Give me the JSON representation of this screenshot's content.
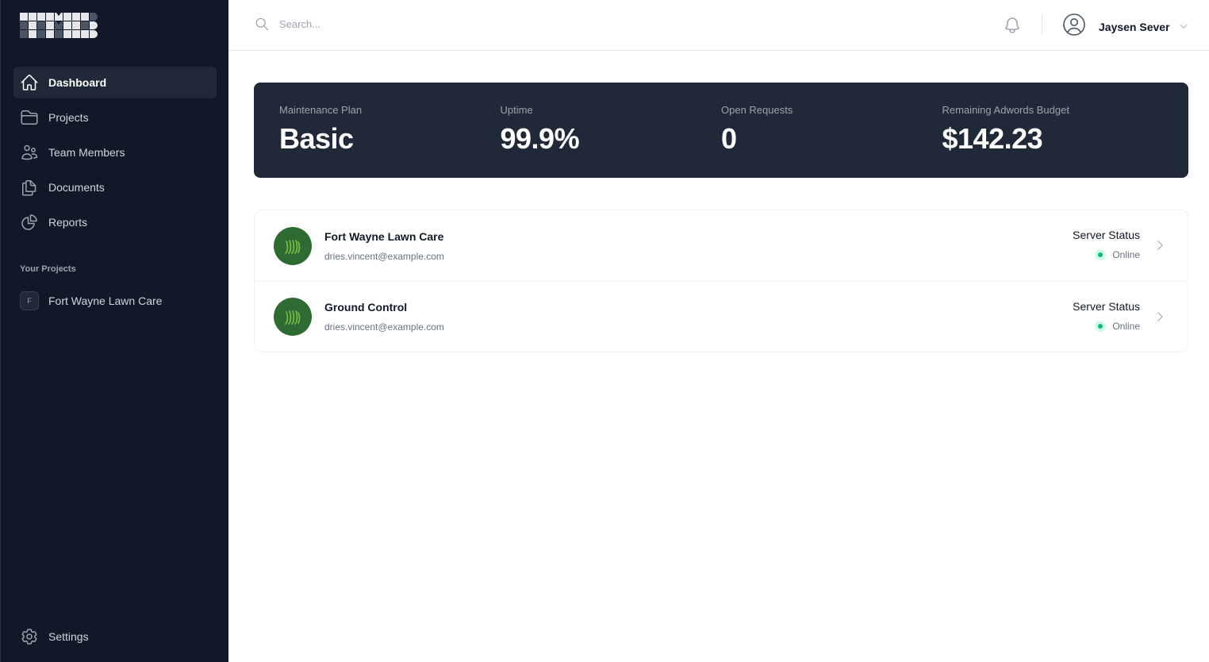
{
  "sidebar": {
    "nav": [
      {
        "label": "Dashboard",
        "icon": "home-icon",
        "active": true
      },
      {
        "label": "Projects",
        "icon": "folder-icon",
        "active": false
      },
      {
        "label": "Team Members",
        "icon": "users-icon",
        "active": false
      },
      {
        "label": "Documents",
        "icon": "documents-icon",
        "active": false
      },
      {
        "label": "Reports",
        "icon": "pie-chart-icon",
        "active": false
      }
    ],
    "section_label": "Your Projects",
    "projects": [
      {
        "initial": "F",
        "label": "Fort Wayne Lawn Care"
      }
    ],
    "settings_label": "Settings"
  },
  "topbar": {
    "search_placeholder": "Search...",
    "user_name": "Jaysen Sever"
  },
  "stats": [
    {
      "label": "Maintenance Plan",
      "value": "Basic"
    },
    {
      "label": "Uptime",
      "value": "99.9%"
    },
    {
      "label": "Open Requests",
      "value": "0"
    },
    {
      "label": "Remaining Adwords Budget",
      "value": "$142.23"
    }
  ],
  "projects": [
    {
      "name": "Fort Wayne Lawn Care",
      "email": "dries.vincent@example.com",
      "status_label": "Server Status",
      "status": "Online"
    },
    {
      "name": "Ground Control",
      "email": "dries.vincent@example.com",
      "status_label": "Server Status",
      "status": "Online"
    }
  ],
  "colors": {
    "sidebar_bg": "#111827",
    "stats_bg": "#1f2937",
    "online": "#10b981",
    "project_logo_bg": "#2d6b33"
  }
}
